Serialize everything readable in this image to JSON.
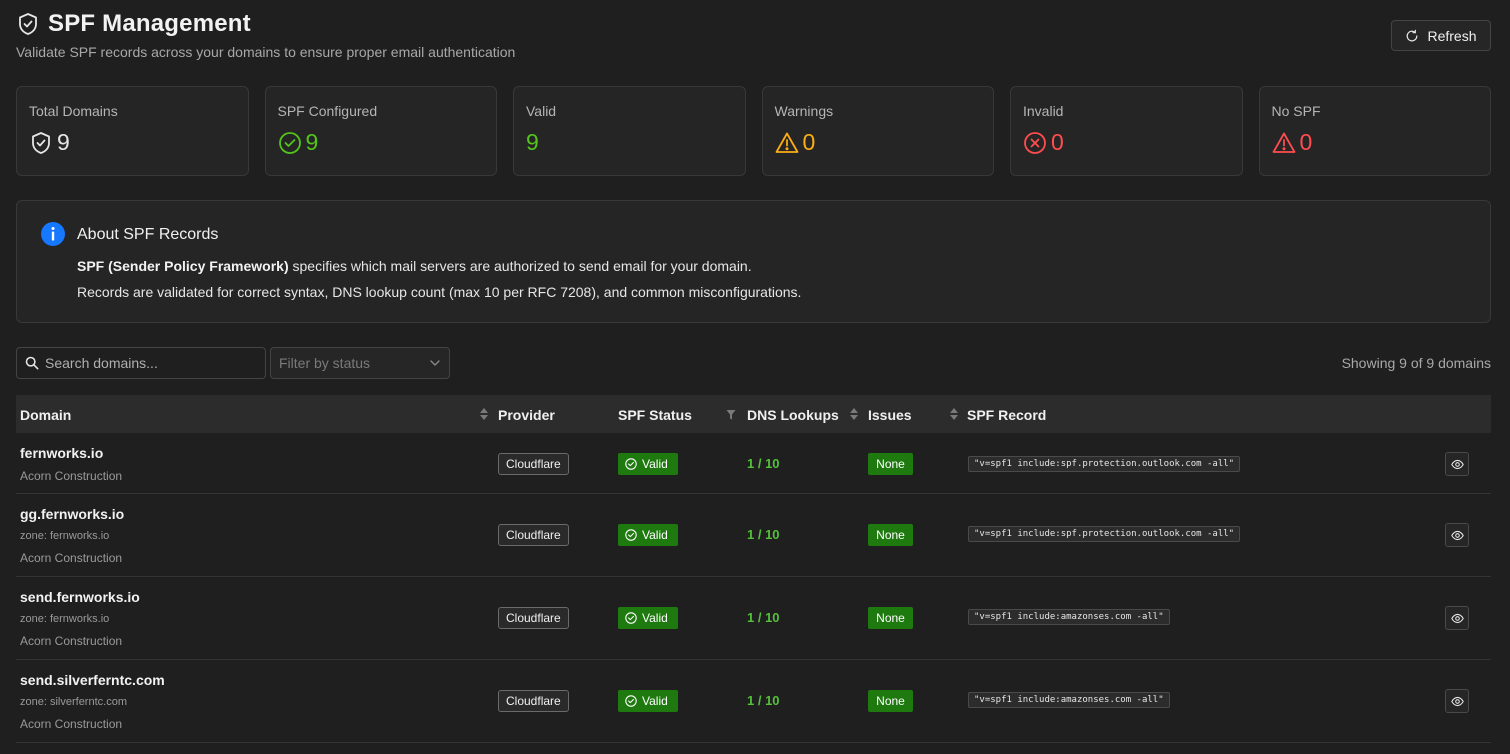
{
  "header": {
    "title": "SPF Management",
    "subtitle": "Validate SPF records across your domains to ensure proper email authentication",
    "refresh_label": "Refresh"
  },
  "stats": [
    {
      "label": "Total Domains",
      "value": "9",
      "icon": "shield-check-icon",
      "color": "#e6e6e6"
    },
    {
      "label": "SPF Configured",
      "value": "9",
      "icon": "check-circle-icon",
      "color": "#52c41a"
    },
    {
      "label": "Valid",
      "value": "9",
      "icon": "",
      "color": "#52c41a"
    },
    {
      "label": "Warnings",
      "value": "0",
      "icon": "warning-triangle-icon",
      "color": "#faad14"
    },
    {
      "label": "Invalid",
      "value": "0",
      "icon": "close-circle-icon",
      "color": "#ff4d4f"
    },
    {
      "label": "No SPF",
      "value": "0",
      "icon": "warning-triangle-icon",
      "color": "#ff4d4f"
    }
  ],
  "about": {
    "title": "About SPF Records",
    "line1_bold": "SPF (Sender Policy Framework)",
    "line1_rest": " specifies which mail servers are authorized to send email for your domain.",
    "line2": "Records are validated for correct syntax, DNS lookup count (max 10 per RFC 7208), and common misconfigurations."
  },
  "toolbar": {
    "search_placeholder": "Search domains...",
    "filter_placeholder": "Filter by status",
    "count_text": "Showing 9 of 9 domains"
  },
  "table": {
    "headers": {
      "domain": "Domain",
      "provider": "Provider",
      "status": "SPF Status",
      "dns": "DNS Lookups",
      "issues": "Issues",
      "record": "SPF Record"
    },
    "rows": [
      {
        "domain": "fernworks.io",
        "zone": "",
        "org": "Acorn Construction",
        "provider": "Cloudflare",
        "status": "Valid",
        "dns": "1 / 10",
        "issues": "None",
        "record": "\"v=spf1 include:spf.protection.outlook.com -all\""
      },
      {
        "domain": "gg.fernworks.io",
        "zone": "zone: fernworks.io",
        "org": "Acorn Construction",
        "provider": "Cloudflare",
        "status": "Valid",
        "dns": "1 / 10",
        "issues": "None",
        "record": "\"v=spf1 include:spf.protection.outlook.com -all\""
      },
      {
        "domain": "send.fernworks.io",
        "zone": "zone: fernworks.io",
        "org": "Acorn Construction",
        "provider": "Cloudflare",
        "status": "Valid",
        "dns": "1 / 10",
        "issues": "None",
        "record": "\"v=spf1 include:amazonses.com -all\""
      },
      {
        "domain": "send.silverferntc.com",
        "zone": "zone: silverferntc.com",
        "org": "Acorn Construction",
        "provider": "Cloudflare",
        "status": "Valid",
        "dns": "1 / 10",
        "issues": "None",
        "record": "\"v=spf1 include:amazonses.com -all\""
      }
    ]
  },
  "colors": {
    "success": "#1e7a0f",
    "success_text": "#55c13a",
    "warning": "#faad14",
    "error": "#ff4d4f",
    "info": "#1677ff"
  }
}
